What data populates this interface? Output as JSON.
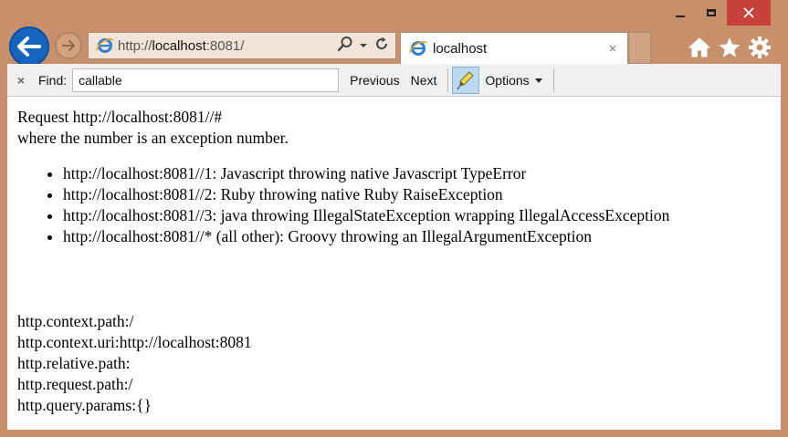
{
  "address": {
    "prefix": "http://",
    "host": "localhost",
    "suffix": ":8081/"
  },
  "tab": {
    "title": "localhost",
    "close_glyph": "×"
  },
  "findbar": {
    "close_glyph": "×",
    "label": "Find:",
    "value": "callable",
    "previous": "Previous",
    "next": "Next",
    "options": "Options"
  },
  "page": {
    "line1": "Request http://localhost:8081//#",
    "line2": "where the number is an exception number.",
    "items": [
      "http://localhost:8081//1: Javascript throwing native Javascript TypeError",
      "http://localhost:8081//2: Ruby throwing native Ruby RaiseException",
      "http://localhost:8081//3: java throwing IllegalStateException wrapping IllegalAccessException",
      "http://localhost:8081//* (all other): Groovy throwing an IllegalArgumentException"
    ],
    "context": [
      "http.context.path:/",
      "http.context.uri:http://localhost:8081",
      "http.relative.path:",
      "http.request.path:/",
      "http.query.params:{}"
    ]
  },
  "colors": {
    "frame": "#c8906a",
    "close_button": "#c7403a",
    "back_button": "#1565c0",
    "ie_logo": "#2b7fd8"
  },
  "icons": {
    "back": "back-arrow-icon",
    "forward": "forward-arrow-icon",
    "favicon": "internet-explorer-icon",
    "search": "search-icon",
    "dropdown": "chevron-down-icon",
    "refresh": "refresh-icon",
    "home": "home-icon",
    "favorites": "star-icon",
    "tools": "gear-icon",
    "highlight": "highlighter-icon"
  }
}
